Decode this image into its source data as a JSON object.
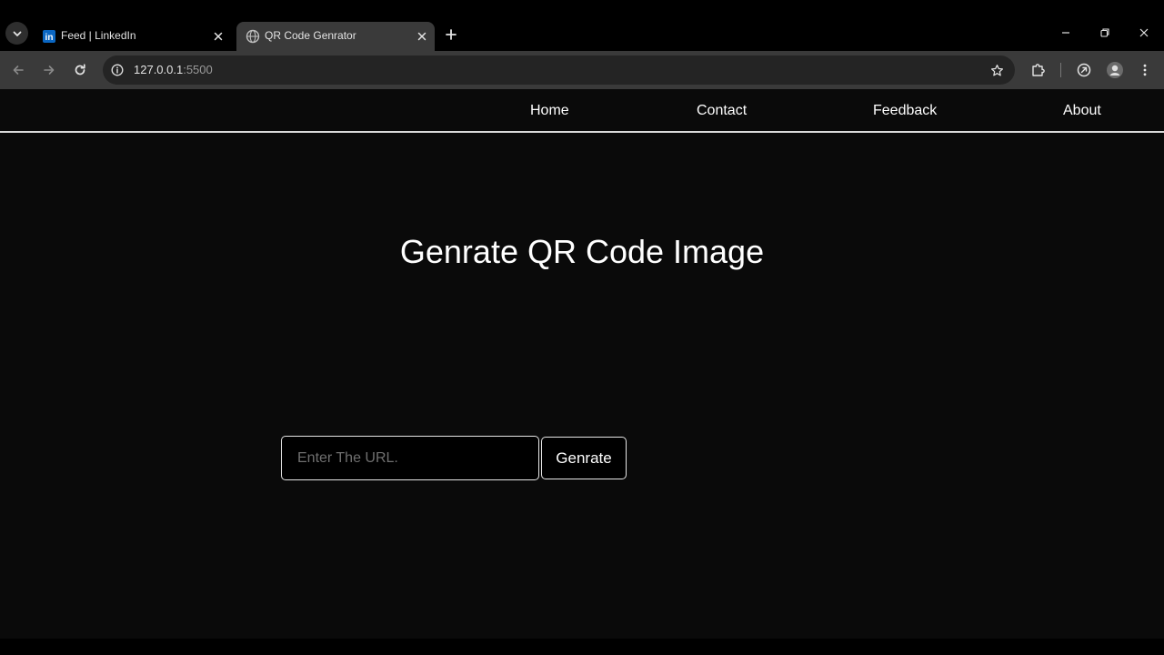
{
  "browser": {
    "tabs": [
      {
        "title": "Feed | LinkedIn",
        "favicon": "linkedin-icon",
        "active": false
      },
      {
        "title": "QR Code Genrator",
        "favicon": "globe-icon",
        "active": true
      }
    ],
    "address_bar": {
      "host": "127.0.0.1",
      "port": ":5500"
    },
    "linkedin_badge": "in",
    "colors": {
      "tabstrip": "#000000",
      "toolbar": "#3a3a3a",
      "omnibox": "#242424",
      "linkedin_blue": "#0a66c2"
    }
  },
  "page": {
    "nav": [
      "Home",
      "Contact",
      "Feedback",
      "About"
    ],
    "title": "Genrate QR Code Image",
    "input": {
      "placeholder": "Enter The URL.",
      "value": ""
    },
    "generate_button": "Genrate",
    "colors": {
      "background": "#0a0a0a",
      "text": "#ffffff",
      "border": "#e6e6e6",
      "placeholder": "#6f6f6f"
    }
  }
}
